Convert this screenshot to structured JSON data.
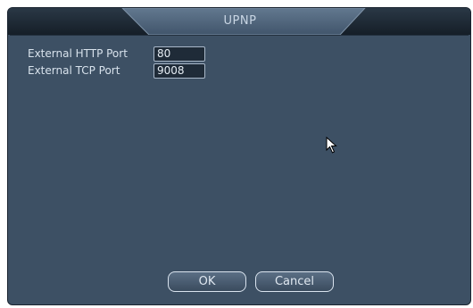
{
  "dialog": {
    "title": "UPNP"
  },
  "fields": {
    "http_port": {
      "label": "External HTTP Port",
      "value": "80"
    },
    "tcp_port": {
      "label": "External TCP Port",
      "value": "9008"
    }
  },
  "buttons": {
    "ok_label": "OK",
    "cancel_label": "Cancel"
  },
  "colors": {
    "panel_background": "#3d5064",
    "title_bar": "#1c2834",
    "title_tab": "#4a5f76",
    "text": "#d8e2ec"
  },
  "icons": {
    "pointer": "mouse-pointer-icon"
  }
}
